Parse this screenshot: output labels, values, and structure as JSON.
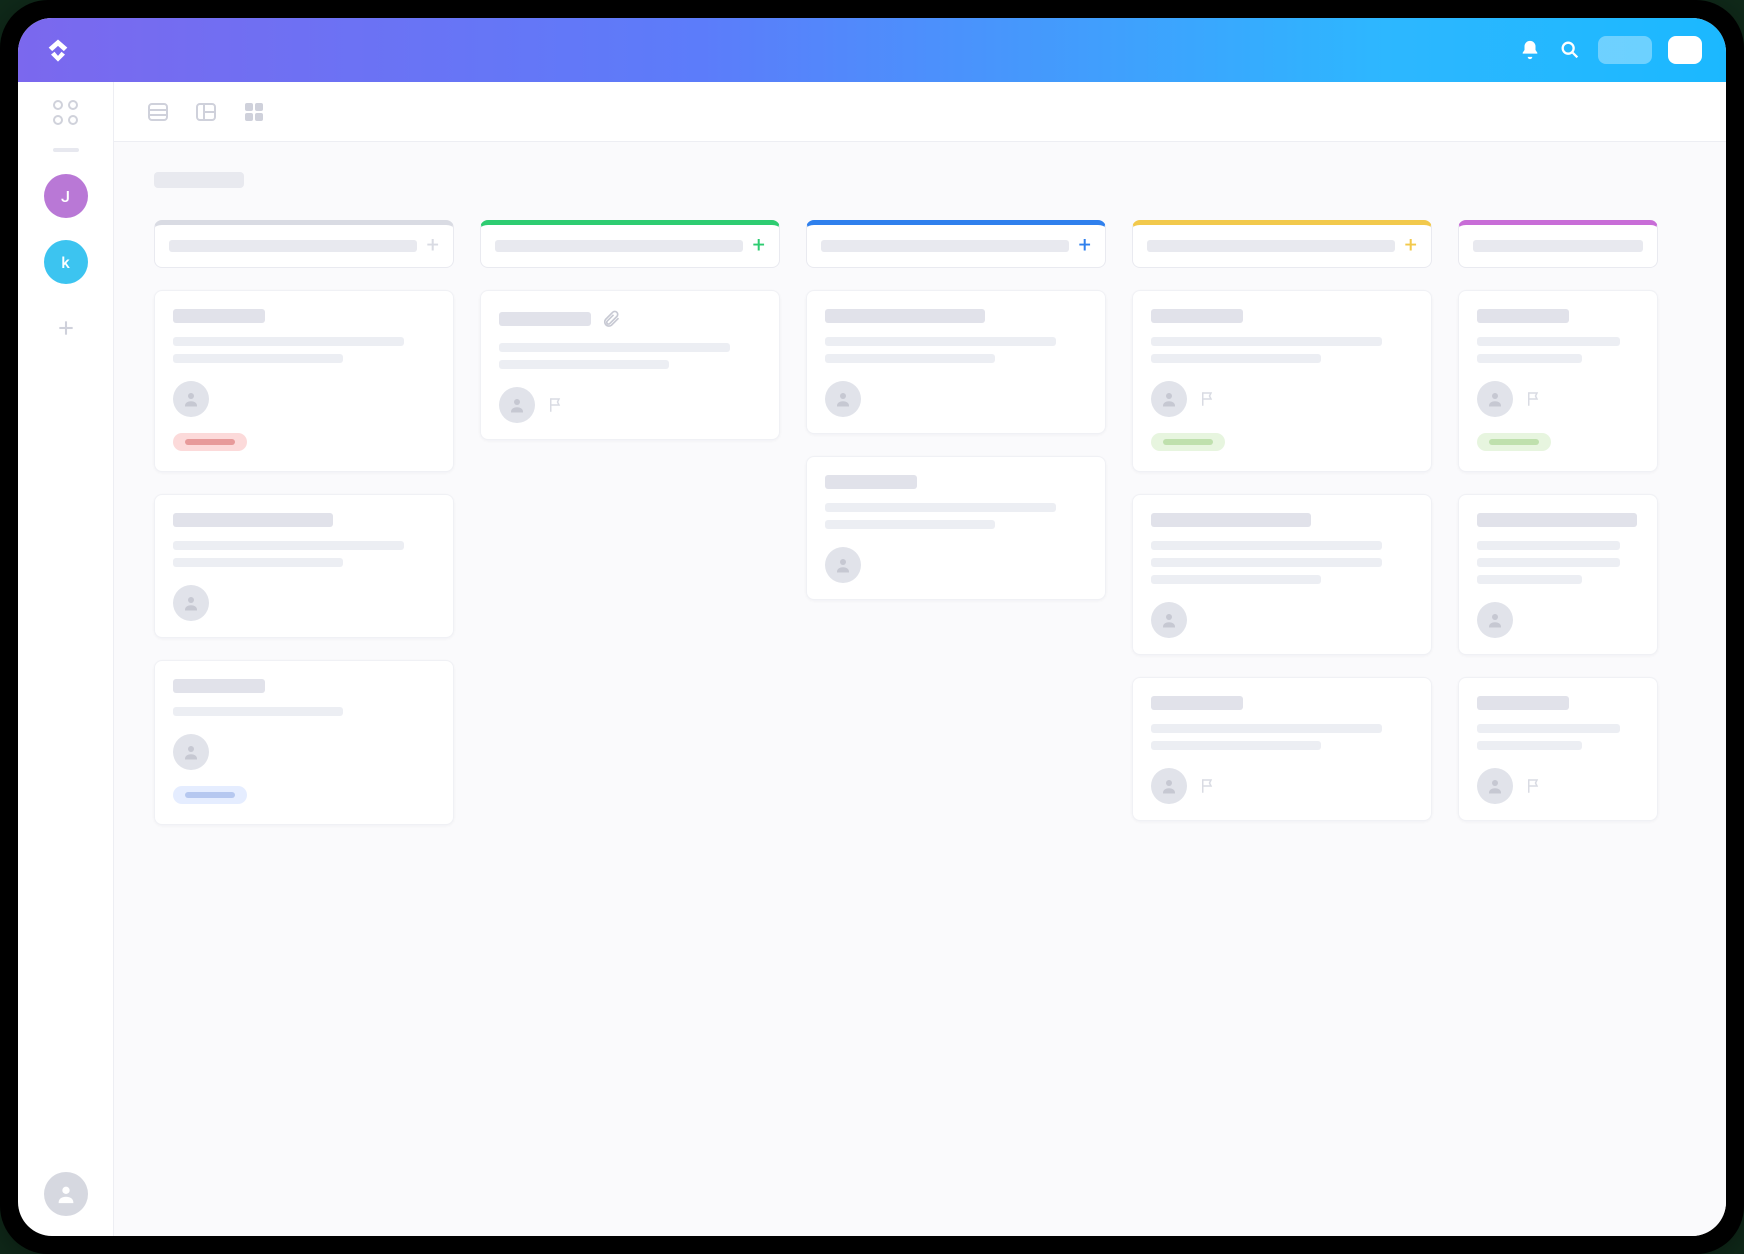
{
  "sidebar": {
    "workspaces": [
      {
        "initial": "J",
        "color": "purple"
      },
      {
        "initial": "k",
        "color": "blue"
      }
    ],
    "add_label": "+"
  },
  "toolbar": {
    "views": [
      "list",
      "board",
      "grid"
    ]
  },
  "board": {
    "columns": [
      {
        "id": "col-gray",
        "accent": "#d9dbe3",
        "add_label": "+",
        "cards": [
          {
            "title_width": "n",
            "has_attachment": false,
            "lines": 2,
            "has_flag": false,
            "tag": "red"
          },
          {
            "title_width": "w",
            "has_attachment": false,
            "lines": 2,
            "has_flag": false,
            "tag": null
          },
          {
            "title_width": "n",
            "has_attachment": false,
            "lines": 1,
            "has_flag": false,
            "tag": "blue"
          }
        ]
      },
      {
        "id": "col-green",
        "accent": "#2ecc71",
        "add_label": "+",
        "cards": [
          {
            "title_width": "n",
            "has_attachment": true,
            "lines": 2,
            "has_flag": true,
            "tag": null
          }
        ]
      },
      {
        "id": "col-blue",
        "accent": "#2f80ed",
        "add_label": "+",
        "cards": [
          {
            "title_width": "w",
            "has_attachment": false,
            "lines": 2,
            "has_flag": false,
            "tag": null
          },
          {
            "title_width": "n",
            "has_attachment": false,
            "lines": 2,
            "has_flag": false,
            "tag": null
          }
        ]
      },
      {
        "id": "col-yellow",
        "accent": "#f2c94c",
        "add_label": "+",
        "cards": [
          {
            "title_width": "n",
            "has_attachment": false,
            "lines": 2,
            "has_flag": true,
            "tag": "green"
          },
          {
            "title_width": "w",
            "has_attachment": false,
            "lines": 3,
            "has_flag": false,
            "tag": null
          },
          {
            "title_width": "n",
            "has_attachment": false,
            "lines": 2,
            "has_flag": true,
            "tag": null
          }
        ]
      },
      {
        "id": "col-purple",
        "accent": "#c86dd7",
        "add_label": "+",
        "cut": true,
        "cards": [
          {
            "title_width": "n",
            "has_attachment": false,
            "lines": 2,
            "has_flag": true,
            "tag": "green"
          },
          {
            "title_width": "w",
            "has_attachment": false,
            "lines": 3,
            "has_flag": false,
            "tag": null
          },
          {
            "title_width": "n",
            "has_attachment": false,
            "lines": 2,
            "has_flag": true,
            "tag": null
          }
        ]
      }
    ]
  }
}
